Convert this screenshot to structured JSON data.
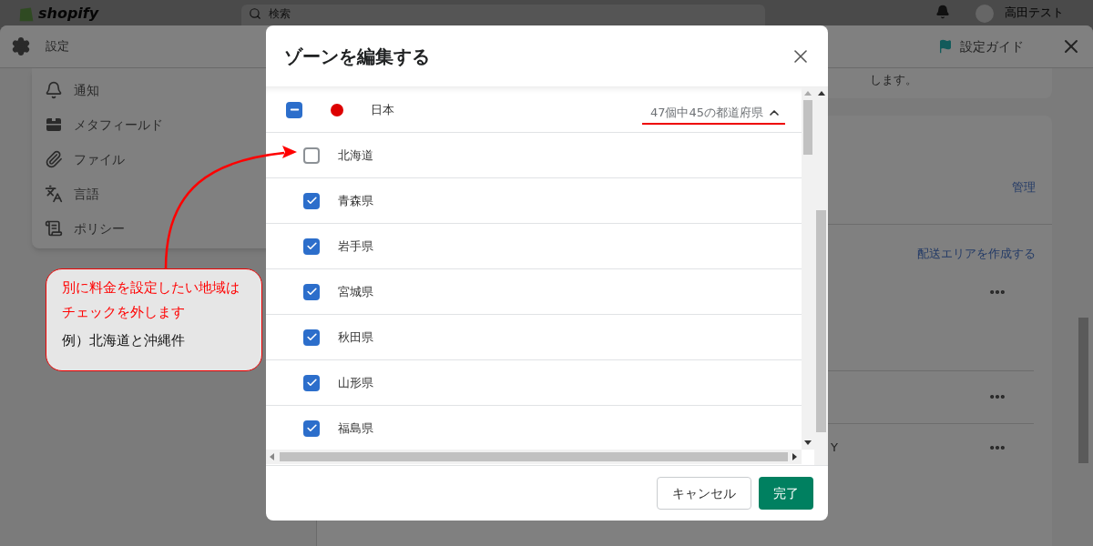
{
  "topbar": {
    "logo": "shopify",
    "search": {
      "placeholder": "検索"
    },
    "user": "高田テスト"
  },
  "settings": {
    "title": "設定",
    "guide": "設定ガイド",
    "nav": [
      {
        "label": "通知"
      },
      {
        "label": "メタフィールド"
      },
      {
        "label": "ファイル"
      },
      {
        "label": "言語"
      },
      {
        "label": "ポリシー"
      }
    ],
    "notice": "します。",
    "manage_link": "管理",
    "create_zone_link": "配送エリアを作成する",
    "zone_rows": [
      {
        "menu": true
      },
      {
        "menu": true
      },
      {
        "menu": true,
        "text": "Y"
      }
    ]
  },
  "modal": {
    "title": "ゾーンを編集する",
    "country": {
      "name": "日本",
      "mixed": true,
      "summary": "47個中45の都道府県",
      "expanded": true
    },
    "regions": [
      {
        "name": "北海道",
        "checked": false
      },
      {
        "name": "青森県",
        "checked": true
      },
      {
        "name": "岩手県",
        "checked": true
      },
      {
        "name": "宮城県",
        "checked": true
      },
      {
        "name": "秋田県",
        "checked": true
      },
      {
        "name": "山形県",
        "checked": true
      },
      {
        "name": "福島県",
        "checked": true
      }
    ],
    "buttons": [
      {
        "label": "キャンセル",
        "kind": "secondary"
      },
      {
        "label": "完了",
        "kind": "primary"
      }
    ]
  },
  "callout": {
    "note": "別に料金を設定したい地域はチェックを外します",
    "example": "例）北海道と沖縄件"
  }
}
